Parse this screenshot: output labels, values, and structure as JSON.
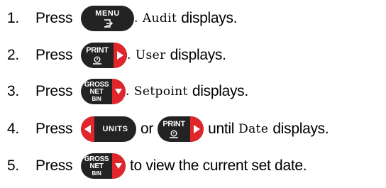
{
  "steps": [
    {
      "number": "1.",
      "press": "Press",
      "after_text": "displays.",
      "display_word": "Audit",
      "period": ".",
      "key": {
        "name": "MENU",
        "icon": "exit-arrow-icon"
      }
    },
    {
      "number": "2.",
      "press": "Press",
      "after_text": "displays.",
      "display_word": "User",
      "period": ".",
      "key": {
        "name": "PRINT",
        "icon": "print-icon",
        "arrow": "right-arrow-icon"
      }
    },
    {
      "number": "3.",
      "press": "Press",
      "after_text": "displays.",
      "display_word": "Setpoint",
      "period": ".",
      "key": {
        "line1": "GROSS",
        "line2": "NET",
        "line3": "B/N",
        "arrow": "down-arrow-icon"
      }
    },
    {
      "number": "4.",
      "press": "Press",
      "or": "or",
      "until": "until",
      "display_word": "Date",
      "after_text": "displays.",
      "key_a": {
        "name": "UNITS",
        "arrow": "left-arrow-icon"
      },
      "key_b": {
        "name": "PRINT",
        "icon": "print-icon",
        "arrow": "right-arrow-icon"
      }
    },
    {
      "number": "5.",
      "press": "Press",
      "after_text": "to view the current set date.",
      "key": {
        "line1": "GROSS",
        "line2": "NET",
        "line3": "B/N",
        "arrow": "down-arrow-icon"
      }
    }
  ],
  "colors": {
    "key_body": "#232323",
    "key_accent": "#e0262b",
    "text": "#000000"
  }
}
